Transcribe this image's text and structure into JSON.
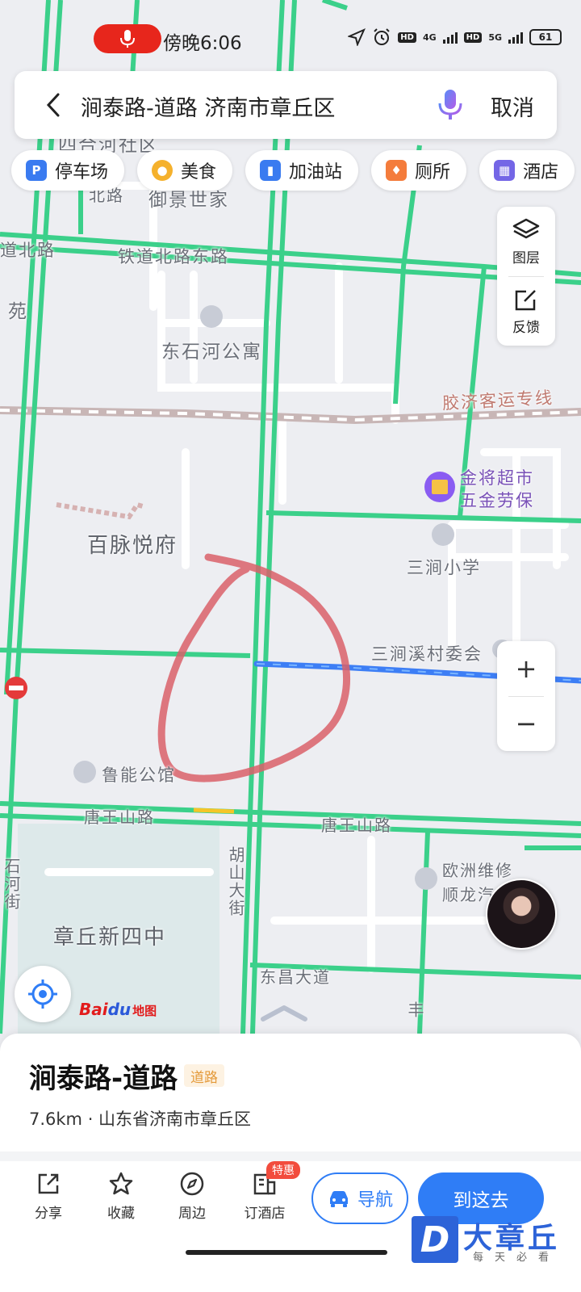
{
  "status_bar": {
    "time": "傍晚6:06",
    "network_1": "4G",
    "network_2": "5G",
    "battery": "61",
    "hd": "HD"
  },
  "search": {
    "query": "涧泰路-道路 济南市章丘区",
    "cancel_label": "取消"
  },
  "categories": [
    {
      "label": "停车场",
      "icon": "parking-icon",
      "color": "#3a7bf0"
    },
    {
      "label": "美食",
      "icon": "food-icon",
      "color": "#f5b12c"
    },
    {
      "label": "加油站",
      "icon": "gas-station-icon",
      "color": "#3a7bf0"
    },
    {
      "label": "厕所",
      "icon": "toilet-icon",
      "color": "#f47c3c"
    },
    {
      "label": "酒店",
      "icon": "hotel-icon",
      "color": "#7466e6"
    }
  ],
  "map_controls": {
    "layers_label": "图层",
    "feedback_label": "反馈",
    "zoom_in": "+",
    "zoom_out": "−"
  },
  "map_labels": {
    "community_top": "四合河社区",
    "estate_top": "御景世家",
    "road_top_left": "北路",
    "road_left": "道北路",
    "road_tiebei": "铁道北路东路",
    "yuan": "苑",
    "dongshihe": "东石河公寓",
    "railway": "胶济客运专线",
    "supermarket_line1": "金将超市",
    "supermarket_line2": "五金劳保",
    "baimai": "百脉悦府",
    "sanjian_school": "三涧小学",
    "sanjian_village": "三涧溪村委会",
    "luneng": "鲁能公馆",
    "tangwang_left": "唐王山路",
    "tangwang_right": "唐王山路",
    "hushan": "胡山大街",
    "shihe": "石河街",
    "ouzhou_line1": "欧洲维修",
    "ouzhou_line2": "顺龙汽",
    "school": "章丘新四中",
    "dongchang": "东昌大道",
    "feng": "丰"
  },
  "logo": {
    "bai": "Bai",
    "du": "du",
    "sub": "地图"
  },
  "place": {
    "name": "涧泰路-道路",
    "tag": "道路",
    "distance_address": "7.6km · 山东省济南市章丘区"
  },
  "actions": {
    "share": "分享",
    "favorite": "收藏",
    "nearby": "周边",
    "hotel": "订酒店",
    "hotel_badge": "特惠",
    "navigate": "导航",
    "go_here": "到这去"
  },
  "watermark": {
    "logo": "D",
    "title": "大章丘",
    "subtitle": "每天必看"
  }
}
